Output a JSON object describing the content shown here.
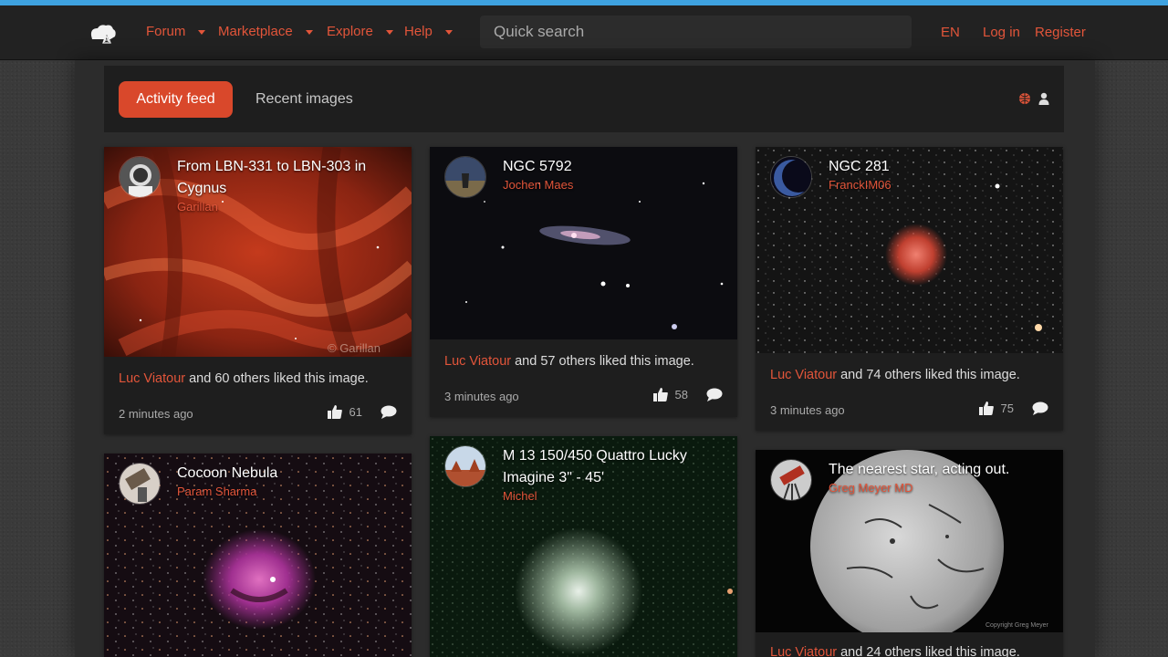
{
  "nav": {
    "items": [
      {
        "label": "Forum"
      },
      {
        "label": "Marketplace"
      },
      {
        "label": "Explore"
      },
      {
        "label": "Help"
      }
    ],
    "search_placeholder": "Quick search",
    "lang": "EN",
    "login": "Log in",
    "register": "Register"
  },
  "tabs": {
    "active": "Activity feed",
    "other": "Recent images"
  },
  "cards": [
    {
      "title": "From LBN-331 to LBN-303 in Cygnus",
      "author": "Garillan",
      "liker": "Luc Viatour",
      "likes_text": " and 60 others liked this image.",
      "time": "2 minutes ago",
      "like_count": "61",
      "watermark": "© Garillan"
    },
    {
      "title": "NGC 5792",
      "author": "Jochen Maes",
      "liker": "Luc Viatour",
      "likes_text": " and 57 others liked this image.",
      "time": "3 minutes ago",
      "like_count": "58"
    },
    {
      "title": "NGC 281",
      "author": "FranckIM06",
      "liker": "Luc Viatour",
      "likes_text": " and 74 others liked this image.",
      "time": "3 minutes ago",
      "like_count": "75"
    },
    {
      "title": "Cocoon Nebula",
      "author": "Param Sharma"
    },
    {
      "title": "M 13 150/450 Quattro Lucky Imagine 3\" - 45'",
      "author": "Michel"
    },
    {
      "title": "The nearest star, acting out.",
      "author": "Greg Meyer MD",
      "liker": "Luc Viatour",
      "likes_text": " and 24 others liked this image.",
      "watermark": "Copyright Greg Meyer"
    }
  ],
  "colors": {
    "accent": "#e2553a",
    "active_tab": "#d9482b",
    "top_stripe": "#3ea2e0"
  }
}
